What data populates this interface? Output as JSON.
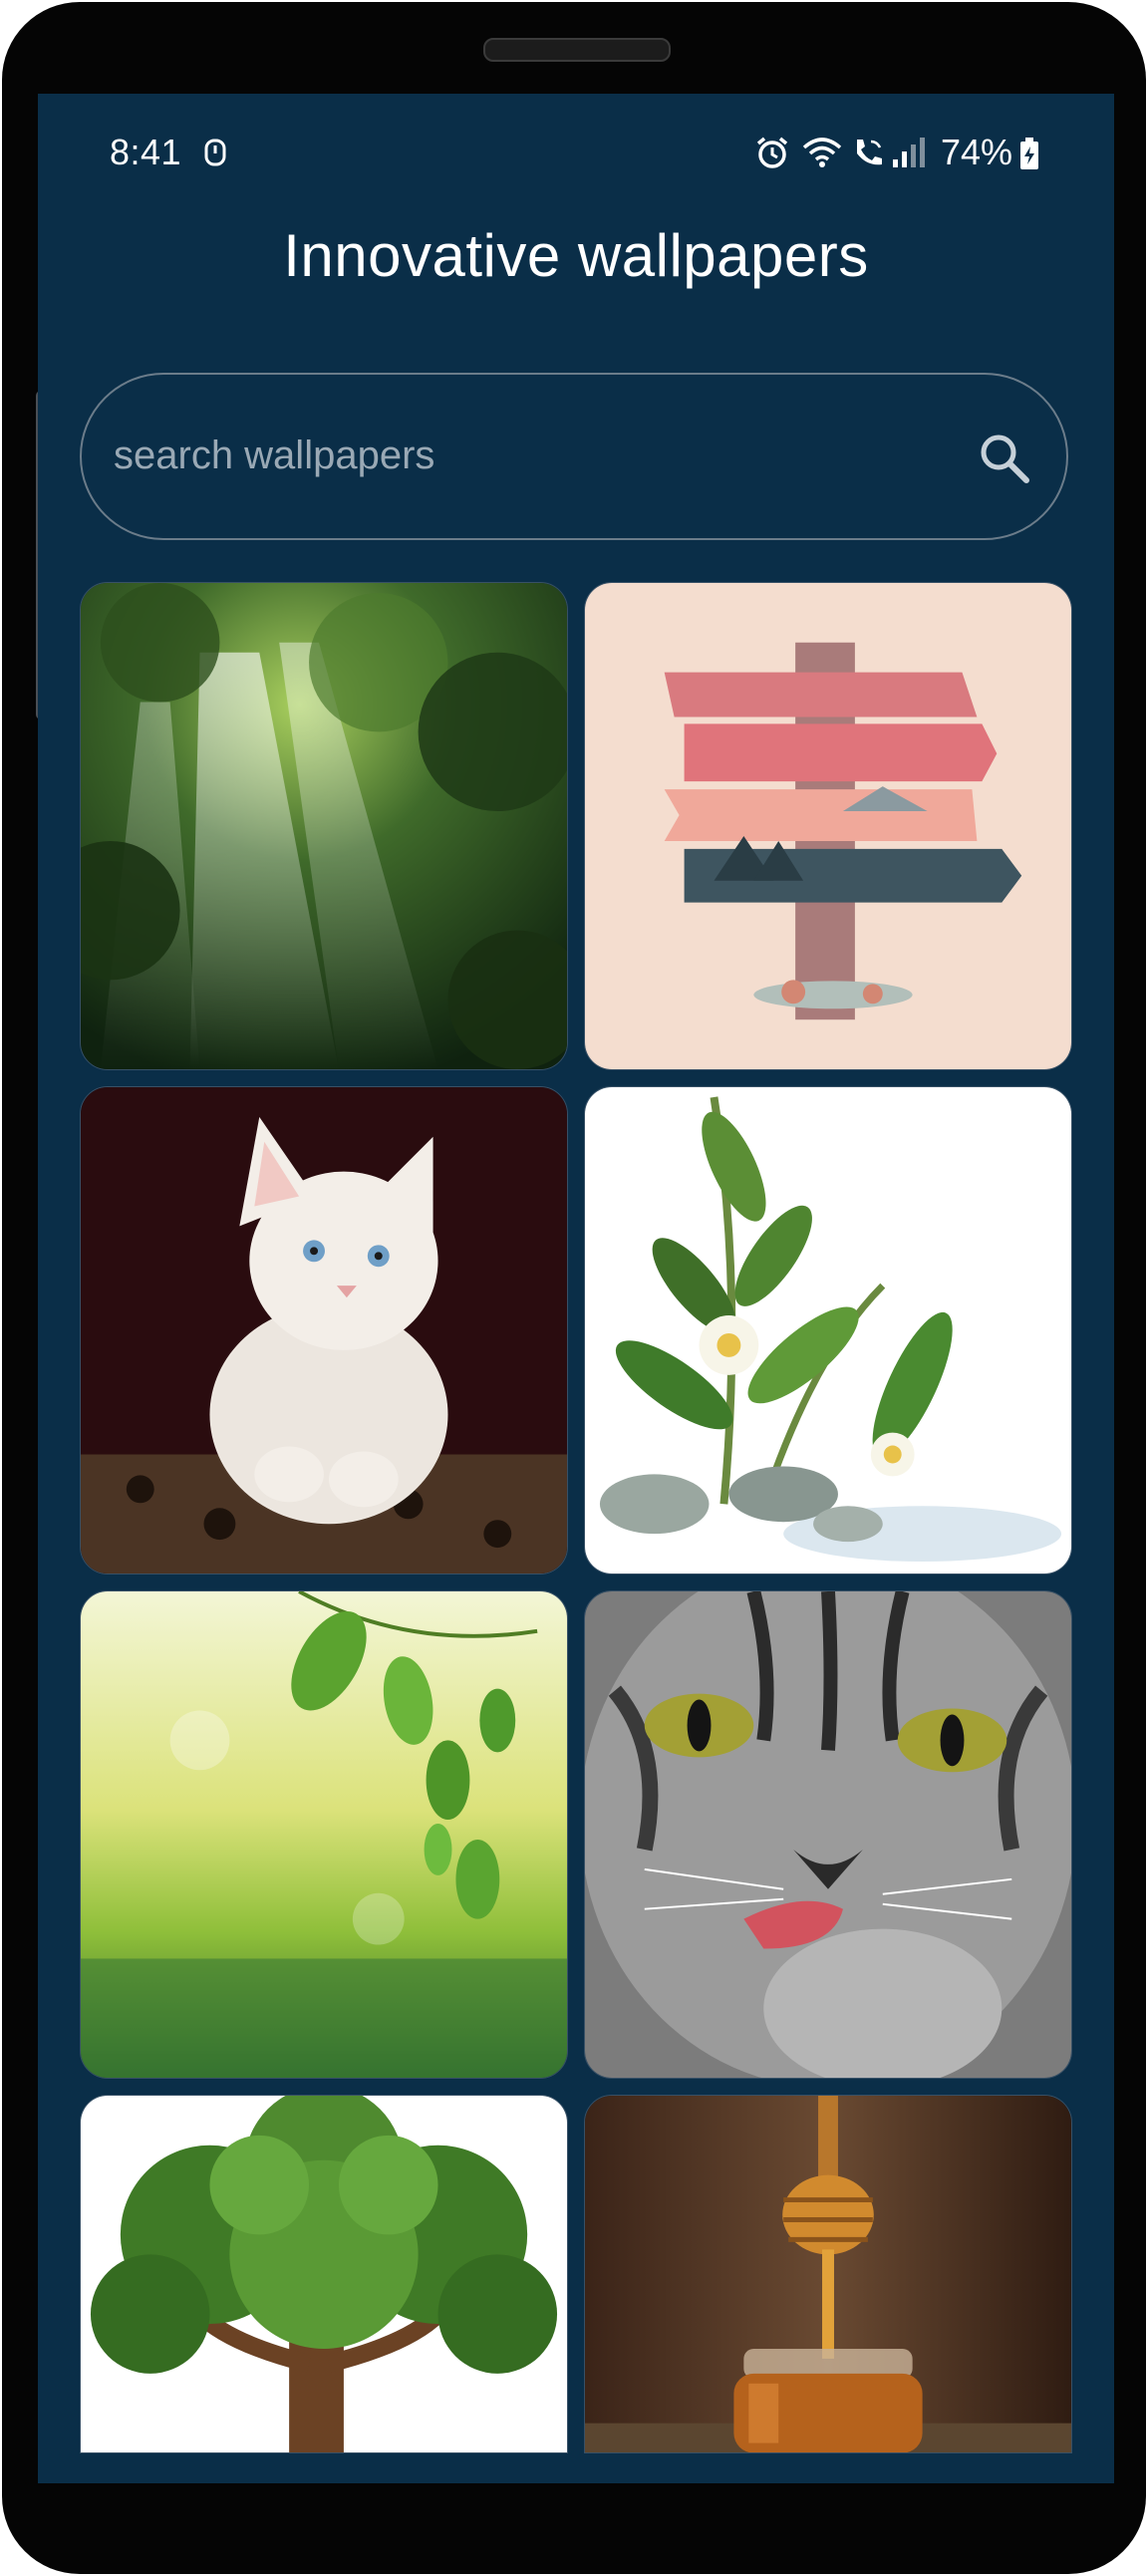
{
  "status_bar": {
    "time": "8:41",
    "battery": "74%",
    "icons": [
      "usb-icon",
      "alarm-icon",
      "wifi-icon",
      "wifi-calling-icon",
      "signal-icon",
      "battery-charging-icon"
    ]
  },
  "header": {
    "title": "Innovative wallpapers"
  },
  "search": {
    "placeholder": "search wallpapers",
    "value": ""
  },
  "wallpapers": [
    {
      "subject": "forest-sunrays"
    },
    {
      "subject": "signpost-illustration"
    },
    {
      "subject": "white-kitten"
    },
    {
      "subject": "flowers-on-stones"
    },
    {
      "subject": "green-leaves-water"
    },
    {
      "subject": "tabby-cat-licking"
    },
    {
      "subject": "green-tree"
    },
    {
      "subject": "honey-dipper-jar"
    }
  ],
  "colors": {
    "background": "#0a2e48",
    "text": "#ffffff",
    "outline": "#6b7c8a"
  }
}
